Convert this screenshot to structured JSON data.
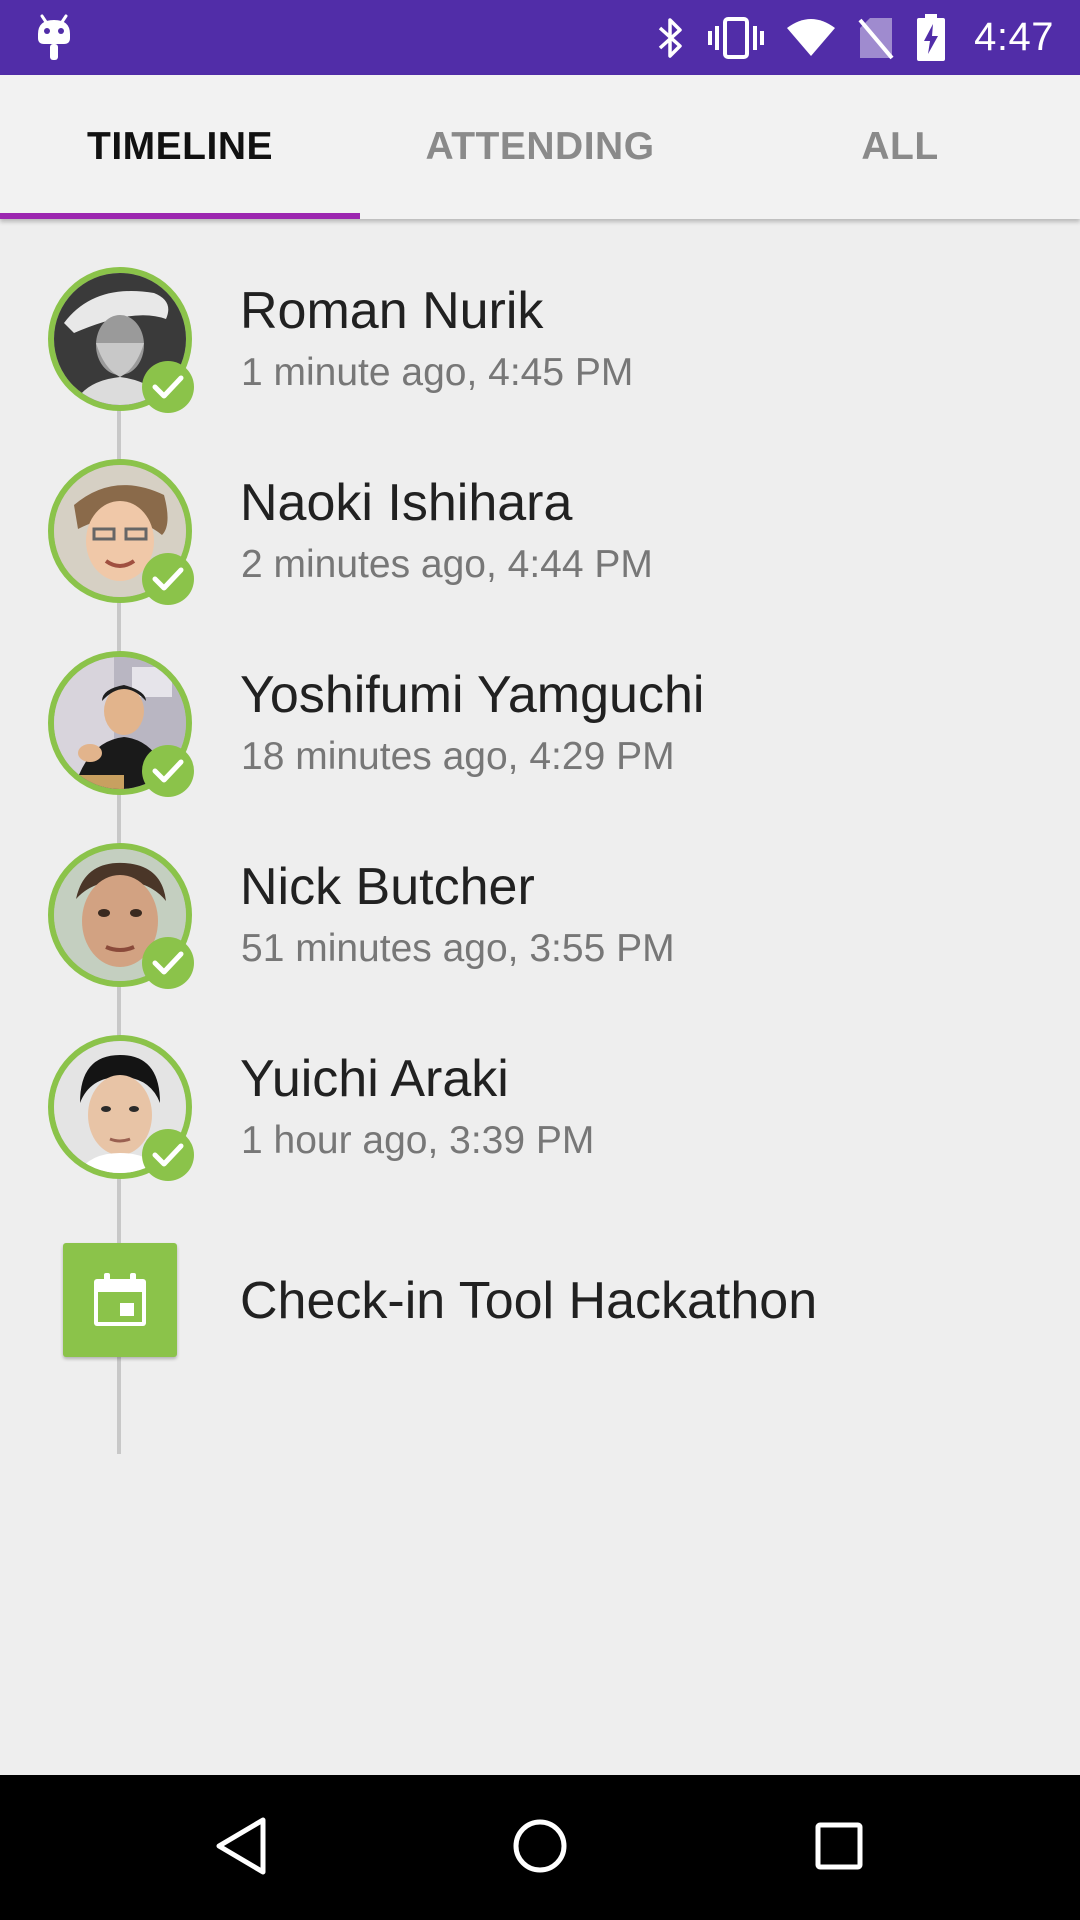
{
  "status_bar": {
    "time": "4:47",
    "icons": [
      "android-debug-icon",
      "bluetooth-icon",
      "vibrate-icon",
      "wifi-icon",
      "no-sim-icon",
      "battery-charging-icon"
    ],
    "background": "#512da8"
  },
  "tabs": [
    {
      "label": "TIMELINE",
      "active": true
    },
    {
      "label": "ATTENDING",
      "active": false
    },
    {
      "label": "ALL",
      "active": false
    }
  ],
  "accent_color": "#9c27b0",
  "check_color": "#8bc34a",
  "timeline": {
    "entries": [
      {
        "name": "Roman Nurik",
        "time": "1 minute ago, 4:45 PM",
        "checked_in": true
      },
      {
        "name": "Naoki Ishihara",
        "time": "2 minutes ago, 4:44 PM",
        "checked_in": true
      },
      {
        "name": "Yoshifumi Yamguchi",
        "time": "18 minutes ago, 4:29 PM",
        "checked_in": true
      },
      {
        "name": "Nick Butcher",
        "time": "51 minutes ago, 3:55 PM",
        "checked_in": true
      },
      {
        "name": "Yuichi Araki",
        "time": "1 hour ago, 3:39 PM",
        "checked_in": true
      }
    ],
    "event": {
      "title": "Check-in Tool Hackathon",
      "icon": "calendar-icon"
    }
  },
  "nav_bar": {
    "buttons": [
      "back-icon",
      "home-icon",
      "recents-icon"
    ]
  }
}
